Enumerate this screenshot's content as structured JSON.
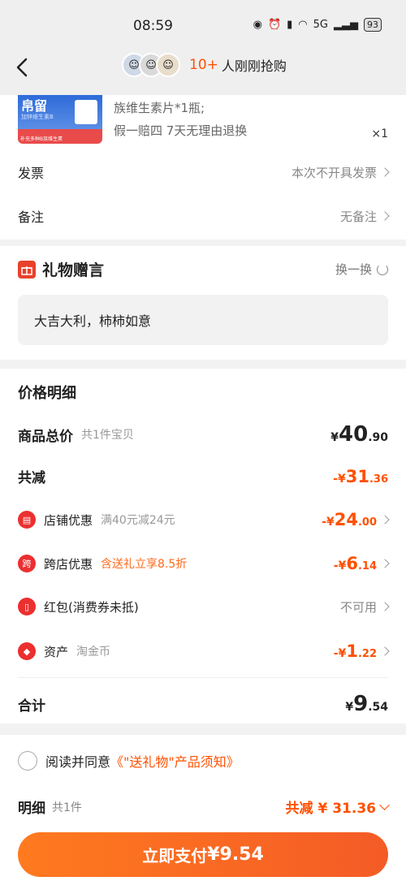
{
  "status_bar": {
    "time": "08:59",
    "network": "5G",
    "battery": "93"
  },
  "header": {
    "buyer_count": "10+",
    "buyer_label": "人刚刚抢购"
  },
  "product": {
    "brand_text": "帛留",
    "thumb_sub": "加锌维生素B",
    "thumb_tag": "补充多种B族维生素",
    "desc_line1": "族维生素片*1瓶;",
    "promise": "假一赔四  7天无理由退换",
    "quantity": "×1"
  },
  "invoice": {
    "label": "发票",
    "value": "本次不开具发票"
  },
  "remark": {
    "label": "备注",
    "value": "无备注"
  },
  "gift_message": {
    "title": "礼物赠言",
    "swap_label": "换一换",
    "text": "大吉大利，柿柿如意"
  },
  "price_details": {
    "title": "价格明细",
    "subtotal": {
      "label": "商品总价",
      "sub": "共1件宝贝",
      "currency": "¥",
      "int": "40",
      "dec": ".90"
    },
    "reduction": {
      "label": "共减",
      "currency": "-¥",
      "int": "31",
      "dec": ".36"
    },
    "items": [
      {
        "label": "店铺优惠",
        "sub": "满40元减24元",
        "amount_cur": "-¥",
        "amount_int": "24",
        "amount_dec": ".00",
        "icon": "store-icon"
      },
      {
        "label": "跨店优惠",
        "sub": "含送礼立享8.5折",
        "amount_cur": "-¥",
        "amount_int": "6",
        "amount_dec": ".14",
        "icon": "cross-store-icon",
        "icon_text": "跨"
      },
      {
        "label": "红包(消费券未抵)",
        "sub": "",
        "value": "不可用",
        "icon": "red-packet-icon"
      },
      {
        "label": "资产",
        "sub": "淘金币",
        "amount_cur": "-¥",
        "amount_int": "1",
        "amount_dec": ".22",
        "icon": "coin-tag-icon"
      }
    ],
    "total": {
      "label": "合计",
      "currency": "¥",
      "int": "9",
      "dec": ".54"
    }
  },
  "footer": {
    "agree_text": "阅读并同意",
    "agree_link": "《\"送礼物\"产品须知》",
    "detail_label": "明细",
    "detail_count": "共1件",
    "detail_reduction": "共减 ¥ 31.36",
    "pay_label": "立即支付",
    "pay_amount": "¥9.54"
  },
  "colors": {
    "accent": "#ff5000",
    "icon_red": "#ec2f2f",
    "button_start": "#ff7a1f",
    "button_end": "#f45b26"
  }
}
